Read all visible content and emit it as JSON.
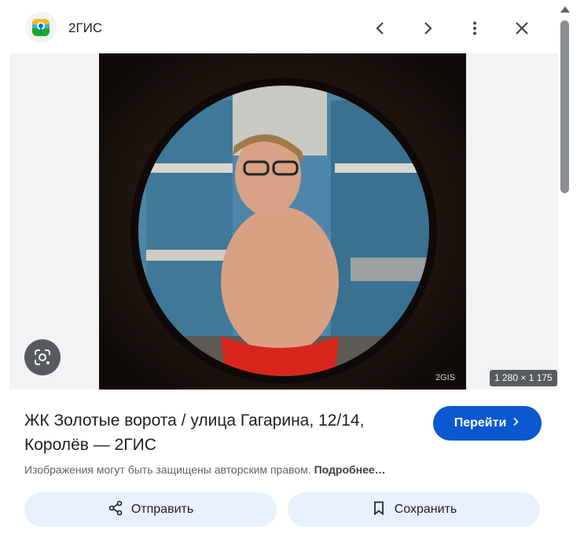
{
  "header": {
    "source_name": "2ГИС",
    "icons": {
      "favicon": "2gis-logo-icon",
      "prev": "chevron-left-icon",
      "next": "chevron-right-icon",
      "more": "more-vert-icon",
      "close": "close-icon"
    }
  },
  "image": {
    "dimensions": "1 280 × 1 175",
    "watermark": "2GIS",
    "lens_icon": "google-lens-icon"
  },
  "result": {
    "title": "ЖК Золотые ворота / улица Гагарина, 12/14, Королёв — 2ГИС",
    "visit_label": "Перейти",
    "visit_icon": "chevron-right-icon"
  },
  "notice": {
    "text": "Изображения могут быть защищены авторским правом.",
    "link": "Подробнее…"
  },
  "actions": {
    "share_label": "Отправить",
    "share_icon": "share-icon",
    "save_label": "Сохранить",
    "save_icon": "bookmark-icon"
  },
  "colors": {
    "accent": "#0b57d0",
    "action_bg": "#e8f0fe",
    "image_bg": "#f1f3f4"
  }
}
